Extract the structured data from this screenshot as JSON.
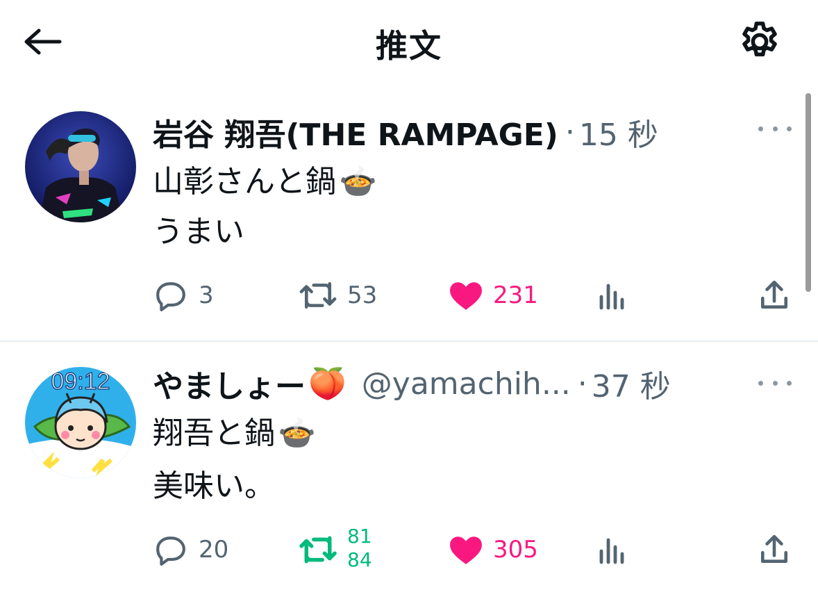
{
  "header": {
    "title": "推文",
    "back_icon": "arrow-left-icon",
    "settings_icon": "gear-icon"
  },
  "tweets": [
    {
      "name": "岩谷 翔吾(THE RAMPAGE)",
      "handle": "",
      "time": "15 秒",
      "lines": [
        "山彰さんと鍋",
        "うまい"
      ],
      "emoji": "🍲",
      "name_emoji": "",
      "actions": {
        "replies": "3",
        "retweets": "53",
        "likes": "231",
        "liked": true,
        "retweeted": false
      }
    },
    {
      "name": "やましょー",
      "name_emoji": "🍑",
      "handle": "@yamachih...",
      "time": "37 秒",
      "lines": [
        "翔吾と鍋",
        "美味い。"
      ],
      "emoji": "🍲",
      "actions": {
        "replies": "20",
        "retweets_old": "81",
        "retweets_new": "84",
        "likes": "305",
        "liked": true,
        "retweeted": true
      }
    }
  ],
  "colors": {
    "like": "#f91880",
    "retweet": "#00ba7c",
    "secondary_text": "#536471",
    "primary_text": "#0f1419",
    "divider": "#e6ecf0"
  },
  "avatar_2_clock": "09:12"
}
